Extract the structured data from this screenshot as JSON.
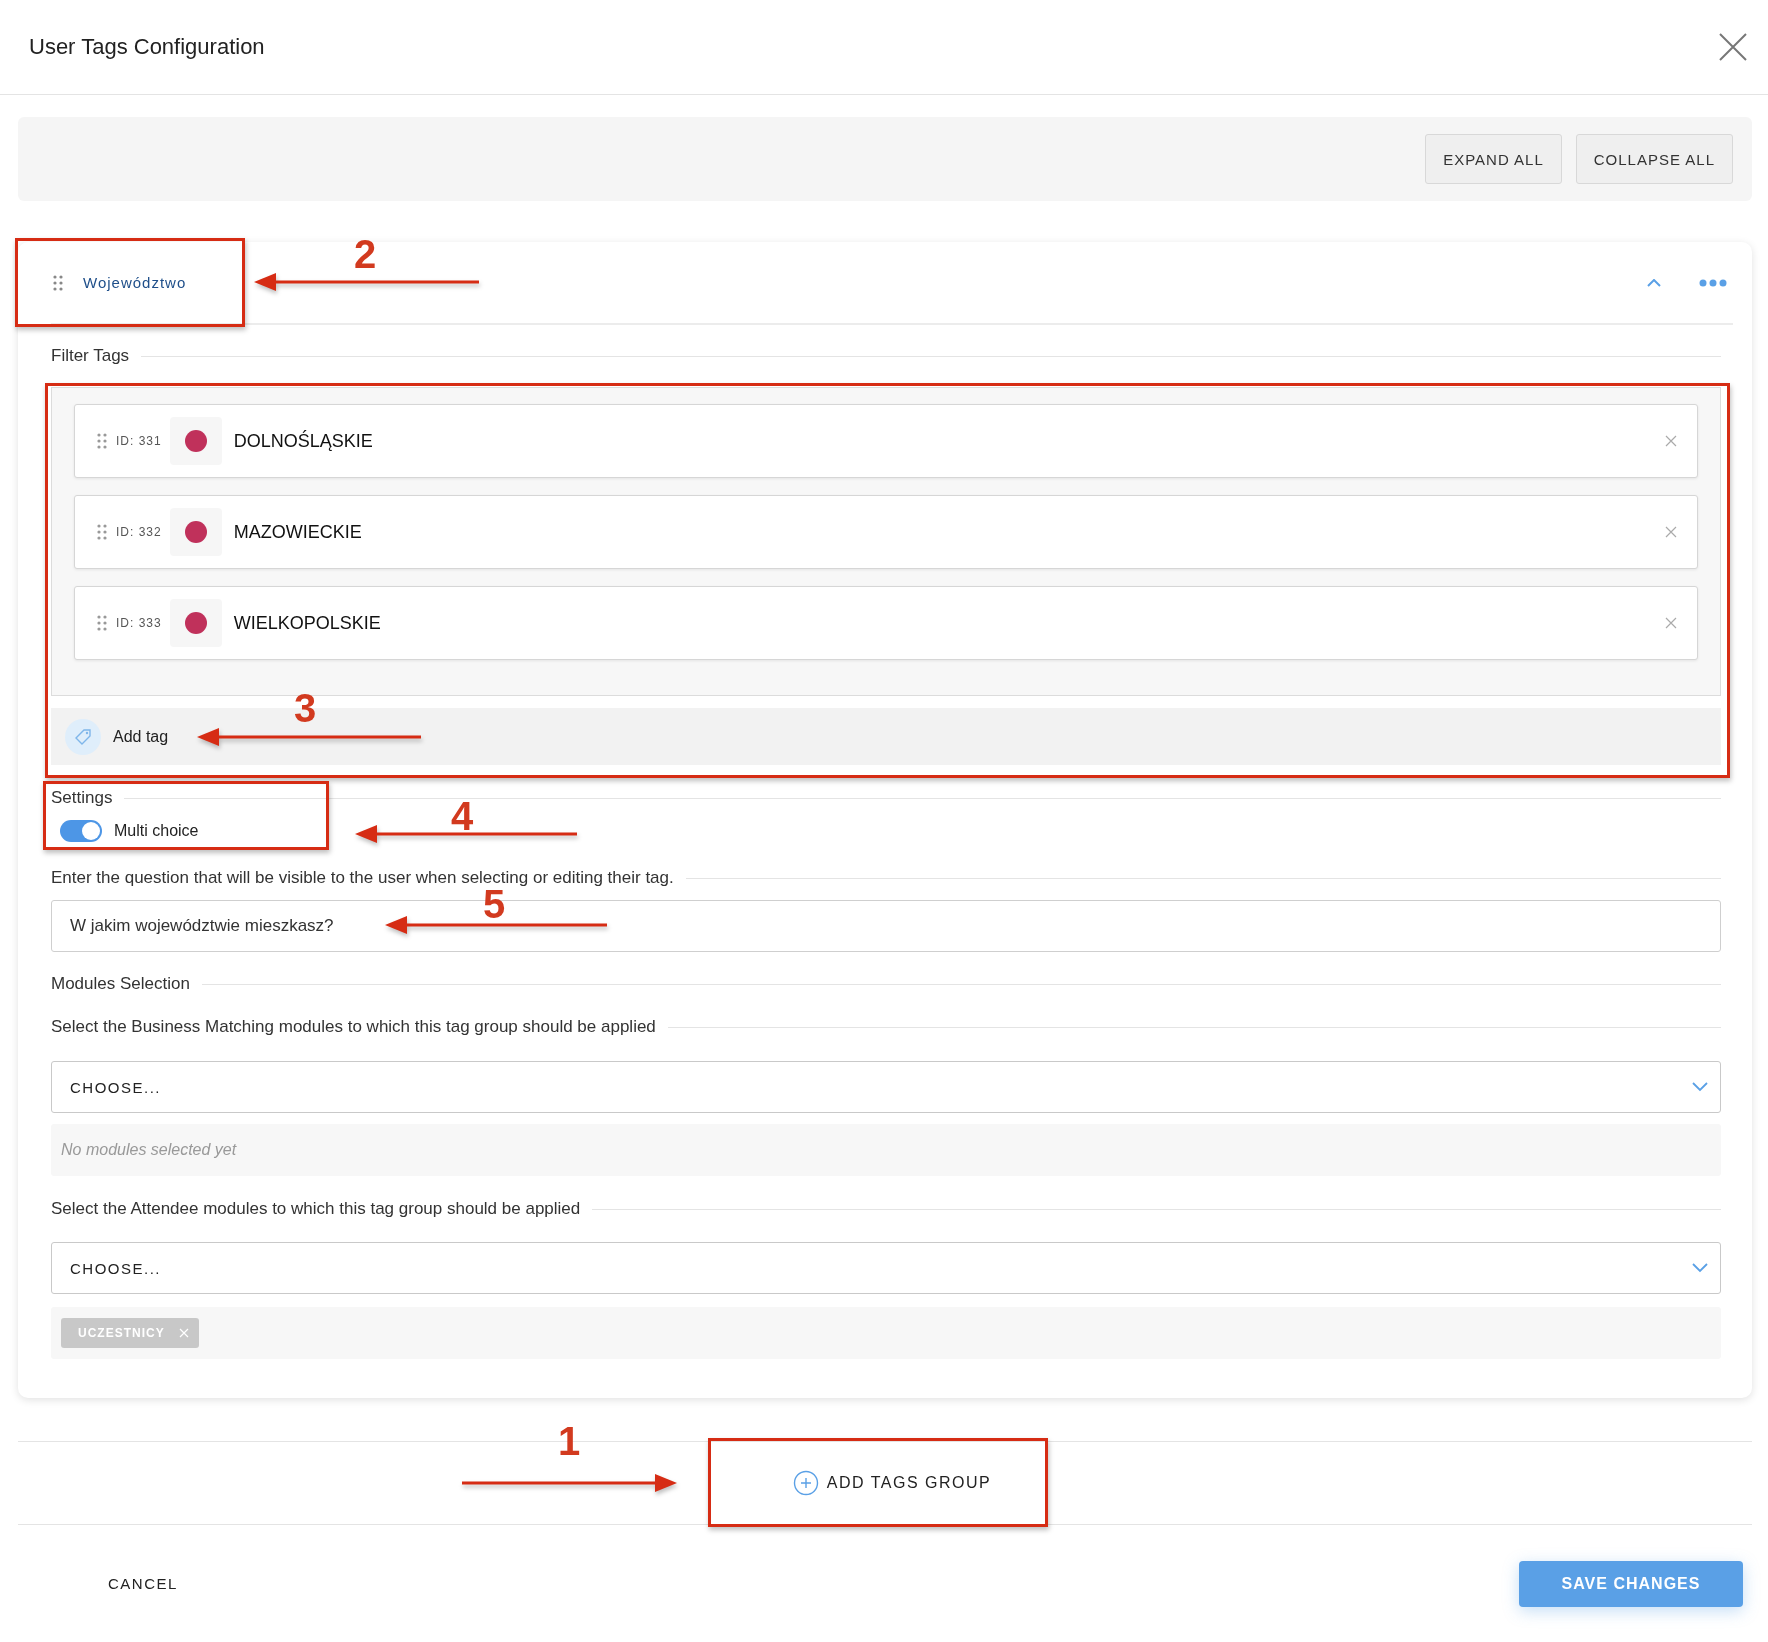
{
  "dialog": {
    "title": "User Tags Configuration"
  },
  "toolbar": {
    "buttons": [
      "EXPAND ALL",
      "COLLAPSE ALL"
    ]
  },
  "group": {
    "name": "Województwo",
    "filter_tags": {
      "label": "Filter Tags",
      "tags": [
        {
          "id": "ID: 331",
          "color": "#c0315b",
          "name": "DOLNOŚLĄSKIE"
        },
        {
          "id": "ID: 332",
          "color": "#c0315b",
          "name": "MAZOWIECKIE"
        },
        {
          "id": "ID: 333",
          "color": "#c0315b",
          "name": "WIELKOPOLSKIE"
        }
      ],
      "add_tag": "Add tag"
    },
    "settings": {
      "label": "Settings",
      "toggle": {
        "label": "Multi choice",
        "on": true
      }
    },
    "question": {
      "label": "Enter the question that will be visible to the user when selecting or editing their tag.",
      "value": "W jakim województwie mieszkasz?"
    },
    "modules": {
      "label": "Modules Selection",
      "selects": [
        {
          "label": "Select the Business Matching modules to which this tag group should be applied",
          "choose": "CHOOSE...",
          "empty": "No modules selected yet"
        },
        {
          "label": "Select the Attendee modules to which this tag group should be applied",
          "choose": "CHOOSE...",
          "chips": [
            "UCZESTNICY"
          ]
        }
      ]
    }
  },
  "add_group": "ADD TAGS GROUP",
  "footer": {
    "cancel": "CANCEL",
    "save": "SAVE CHANGES"
  },
  "annotations": [
    {
      "number": "2",
      "boxed": true
    },
    {
      "number": "3",
      "boxed": true
    },
    {
      "number": "4",
      "boxed": true
    },
    {
      "number": "5",
      "boxed": false
    },
    {
      "number": "1",
      "boxed": true
    }
  ]
}
